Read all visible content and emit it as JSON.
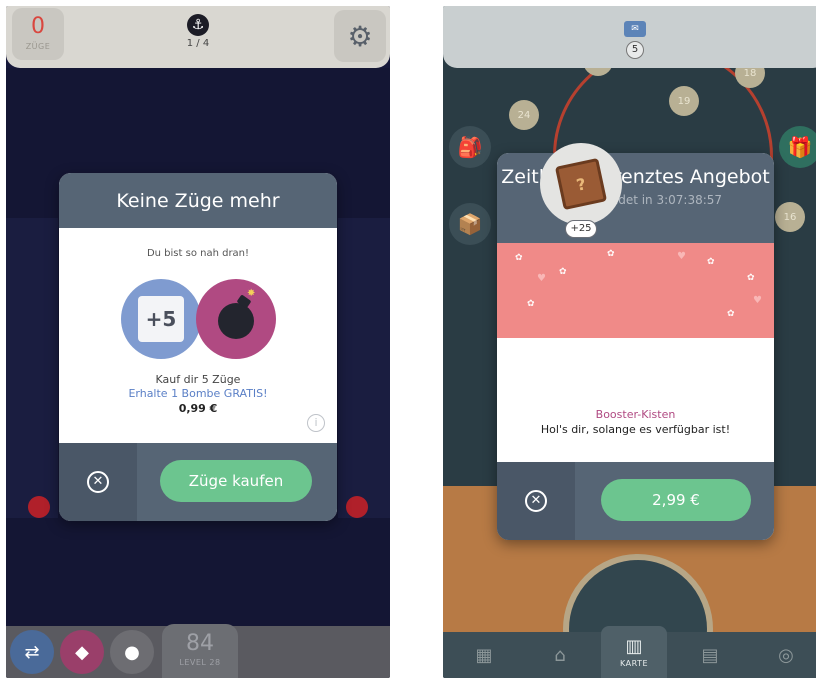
{
  "left_screen": {
    "header": {
      "moves_count": "0",
      "moves_label": "ZÜGE",
      "level_progress": "1 / 4"
    },
    "bottom_bar": {
      "level_number": "84",
      "level_label": "LEVEL 28"
    },
    "dialog": {
      "title": "Keine Züge mehr",
      "subtitle": "Du bist so nah dran!",
      "plus_moves": "+5",
      "offer_text": "Kauf dir 5 Züge",
      "bonus_text": "Erhalte 1 Bombe GRATIS!",
      "price": "0,99 €",
      "info_glyph": "i",
      "close_glyph": "✕",
      "buy_label": "Züge kaufen"
    },
    "icons": [
      "anchor-icon",
      "gear-icon",
      "shuffle-icon",
      "eraser-icon",
      "info-icon",
      "close-icon"
    ],
    "colors": {
      "primary_button": "#6cc58f",
      "dialog_header": "#566575",
      "bonus_text": "#5a7fc6",
      "moves_count": "#d9463e"
    }
  },
  "right_screen": {
    "header": {
      "inbox_count": "5"
    },
    "map_levels": [
      "24",
      "19",
      "18",
      "16"
    ],
    "dialog": {
      "title": "Zeitlich begrenztes Angebot",
      "countdown": "Angebot endet in 3:07:38:57",
      "crate_amount": "+25",
      "item_name": "Booster-Kisten",
      "item_description": "Hol's dir, solange es verfügbar ist!",
      "close_glyph": "✕",
      "buy_label": "2,99 €"
    },
    "nav": {
      "active_label": "KARTE"
    },
    "icons": [
      "mail-icon",
      "backpack-icon",
      "gift-icon",
      "crate-icon",
      "shop-icon",
      "map-icon",
      "news-icon",
      "badge-icon",
      "close-icon"
    ],
    "colors": {
      "primary_button": "#6cc58f",
      "banner": "#f08a88",
      "item_name": "#b04a82"
    }
  }
}
